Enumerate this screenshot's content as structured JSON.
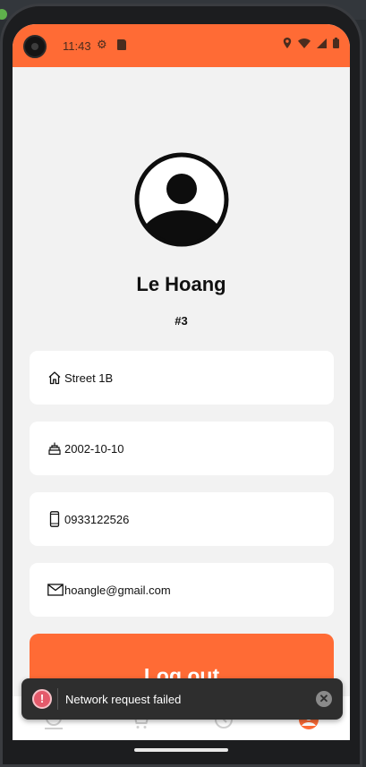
{
  "status_bar": {
    "time": "11:43",
    "background": "#ff6b35"
  },
  "profile": {
    "name": "Le Hoang",
    "id": "#3",
    "address": "Street 1B",
    "birthday": "2002-10-10",
    "phone": "0933122526",
    "email": "hoangle@gmail.com"
  },
  "actions": {
    "logout_label": "Log out"
  },
  "bottom_nav": {
    "items": [
      {
        "icon": "home-icon"
      },
      {
        "icon": "cart-icon"
      },
      {
        "icon": "history-icon"
      },
      {
        "icon": "profile-icon",
        "active": true
      }
    ],
    "active_color": "#ff6b35"
  },
  "toast": {
    "message": "Network request failed",
    "type": "error"
  },
  "colors": {
    "accent": "#ff6b35",
    "background": "#f2f2f2",
    "card": "#ffffff",
    "error": "#e45a6b"
  }
}
